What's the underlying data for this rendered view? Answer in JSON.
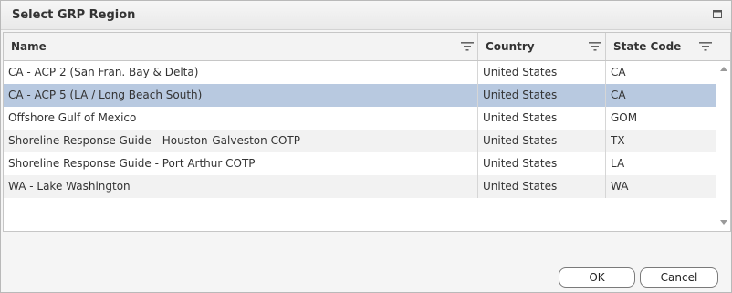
{
  "dialog": {
    "title": "Select GRP Region",
    "maximize_icon": "maximize-icon"
  },
  "table": {
    "columns": [
      {
        "label": "Name",
        "filter_icon": "filter-icon"
      },
      {
        "label": "Country",
        "filter_icon": "filter-icon"
      },
      {
        "label": "State Code",
        "filter_icon": "filter-icon"
      }
    ],
    "rows": [
      {
        "name": "CA - ACP 2 (San Fran. Bay & Delta)",
        "country": "United States",
        "state": "CA",
        "selected": false
      },
      {
        "name": "CA - ACP 5 (LA / Long Beach South)",
        "country": "United States",
        "state": "CA",
        "selected": true
      },
      {
        "name": "Offshore Gulf of Mexico",
        "country": "United States",
        "state": "GOM",
        "selected": false
      },
      {
        "name": "Shoreline Response Guide - Houston-Galveston COTP",
        "country": "United States",
        "state": "TX",
        "selected": false
      },
      {
        "name": "Shoreline Response Guide - Port Arthur COTP",
        "country": "United States",
        "state": "LA",
        "selected": false
      },
      {
        "name": "WA - Lake Washington",
        "country": "United States",
        "state": "WA",
        "selected": false
      }
    ],
    "selected_color": "#b8c9e0"
  },
  "buttons": {
    "ok_label": "OK",
    "cancel_label": "Cancel"
  }
}
